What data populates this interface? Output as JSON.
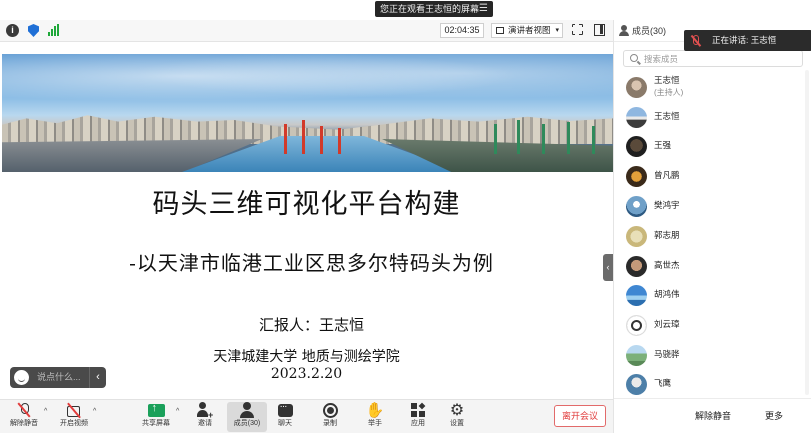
{
  "banner": {
    "viewing_text": "您正在观看王志恒的屏幕",
    "menu_glyph": "☰"
  },
  "toolbar": {
    "timer": "02:04:35",
    "view_mode": "演讲者视图",
    "caret": "▾",
    "signal_color": "#1fa83a",
    "shield_color": "#1f6fd6"
  },
  "slide": {
    "title": "码头三维可视化平台构建",
    "subtitle": "-以天津市临港工业区思多尔特码头为例",
    "reporter": "汇报人：王志恒",
    "institution": "天津城建大学 地质与测绘学院",
    "date": "2023.2.20"
  },
  "reaction_bar": {
    "placeholder": "说点什么...",
    "collapse_glyph": "‹"
  },
  "panel_handle_glyph": "‹",
  "bottom_bar": {
    "items": [
      {
        "label": "解除静音",
        "icon": "mic-muted-icon"
      },
      {
        "label": "开启视频",
        "icon": "camera-off-icon"
      },
      {
        "label": "共享屏幕",
        "icon": "share-screen-icon"
      },
      {
        "label": "邀请",
        "icon": "invite-icon"
      },
      {
        "label": "成员(30)",
        "icon": "participants-icon"
      },
      {
        "label": "聊天",
        "icon": "chat-icon"
      },
      {
        "label": "录制",
        "icon": "record-icon"
      },
      {
        "label": "举手",
        "icon": "raise-hand-icon"
      },
      {
        "label": "应用",
        "icon": "apps-icon"
      },
      {
        "label": "设置",
        "icon": "gear-icon"
      }
    ],
    "caret": "^",
    "hand_glyph": "✋",
    "gear_glyph": "⚙",
    "leave_label": "离开会议",
    "leave_color": "#e03b3b",
    "share_color": "#1aa05a"
  },
  "right_panel": {
    "title": "成员(30)",
    "speaking": "正在讲话: 王志恒",
    "search_placeholder": "搜索成员",
    "members": [
      {
        "name": "王志恒",
        "role": "(主持人)"
      },
      {
        "name": "王志恒",
        "role": ""
      },
      {
        "name": "王强",
        "role": ""
      },
      {
        "name": "曾凡鹏",
        "role": ""
      },
      {
        "name": "樊鸿宇",
        "role": ""
      },
      {
        "name": "郭志朋",
        "role": ""
      },
      {
        "name": "高世杰",
        "role": ""
      },
      {
        "name": "胡鸿伟",
        "role": ""
      },
      {
        "name": "刘云璋",
        "role": ""
      },
      {
        "name": "马骁骅",
        "role": ""
      },
      {
        "name": "飞鹰",
        "role": ""
      }
    ],
    "unmute_all": "解除静音",
    "more": "更多"
  }
}
